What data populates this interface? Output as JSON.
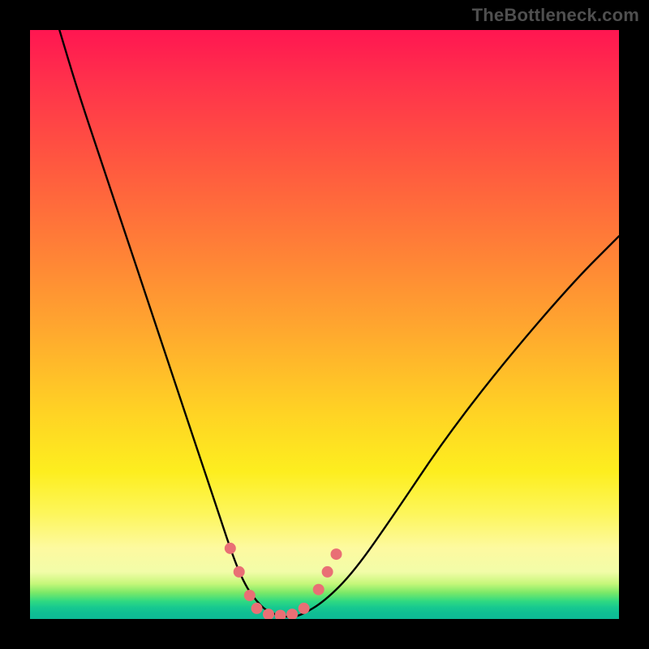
{
  "watermark": "TheBottleneck.com",
  "chart_data": {
    "type": "line",
    "title": "",
    "xlabel": "",
    "ylabel": "",
    "xlim": [
      0,
      100
    ],
    "ylim": [
      0,
      100
    ],
    "series": [
      {
        "name": "curve",
        "color": "#000000",
        "x": [
          5,
          8,
          12,
          16,
          20,
          24,
          27,
          30,
          32,
          34,
          35.5,
          37,
          38.5,
          40,
          42,
          44,
          46,
          50,
          55,
          62,
          70,
          80,
          92,
          100
        ],
        "y": [
          100,
          90,
          78,
          66,
          54,
          42,
          33,
          24,
          18,
          12,
          8,
          5,
          3,
          1.5,
          0.6,
          0.3,
          0.6,
          3,
          8,
          18,
          30,
          43,
          57,
          65
        ]
      }
    ],
    "markers": {
      "name": "highlight-points",
      "shape": "circle",
      "color": "#e96f75",
      "radius_px": 7,
      "points": [
        {
          "x": 34.0,
          "y": 12.0
        },
        {
          "x": 35.5,
          "y": 8.0
        },
        {
          "x": 37.3,
          "y": 4.0
        },
        {
          "x": 38.5,
          "y": 1.8
        },
        {
          "x": 40.5,
          "y": 0.8
        },
        {
          "x": 42.5,
          "y": 0.6
        },
        {
          "x": 44.5,
          "y": 0.8
        },
        {
          "x": 46.5,
          "y": 1.8
        },
        {
          "x": 49.0,
          "y": 5.0
        },
        {
          "x": 50.5,
          "y": 8.0
        },
        {
          "x": 52.0,
          "y": 11.0
        }
      ]
    },
    "gradient_stops": [
      {
        "pos": 0.0,
        "color": "#ff1651"
      },
      {
        "pos": 0.35,
        "color": "#ff7a38"
      },
      {
        "pos": 0.65,
        "color": "#ffd324"
      },
      {
        "pos": 0.88,
        "color": "#fdfaa0"
      },
      {
        "pos": 0.97,
        "color": "#2fd982"
      },
      {
        "pos": 1.0,
        "color": "#0db995"
      }
    ]
  }
}
